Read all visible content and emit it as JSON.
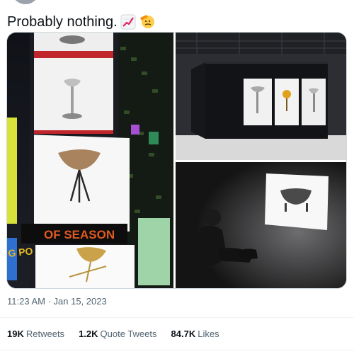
{
  "tweet": {
    "text": "Probably nothing.",
    "emojis": [
      "chart-increasing-icon",
      "saluting-face-icon"
    ],
    "timestamp": "11:23 AM · Jan 15, 2023"
  },
  "media": {
    "billboard_text": "OF SEASON",
    "billboard_side_text": "G PO"
  },
  "stats": {
    "retweets_count": "19K",
    "retweets_label": "Retweets",
    "quotes_count": "1.2K",
    "quotes_label": "Quote Tweets",
    "likes_count": "84.7K",
    "likes_label": "Likes"
  },
  "colors": {
    "text": "#0f1419",
    "secondary": "#536471",
    "divider": "#eff3f4"
  }
}
